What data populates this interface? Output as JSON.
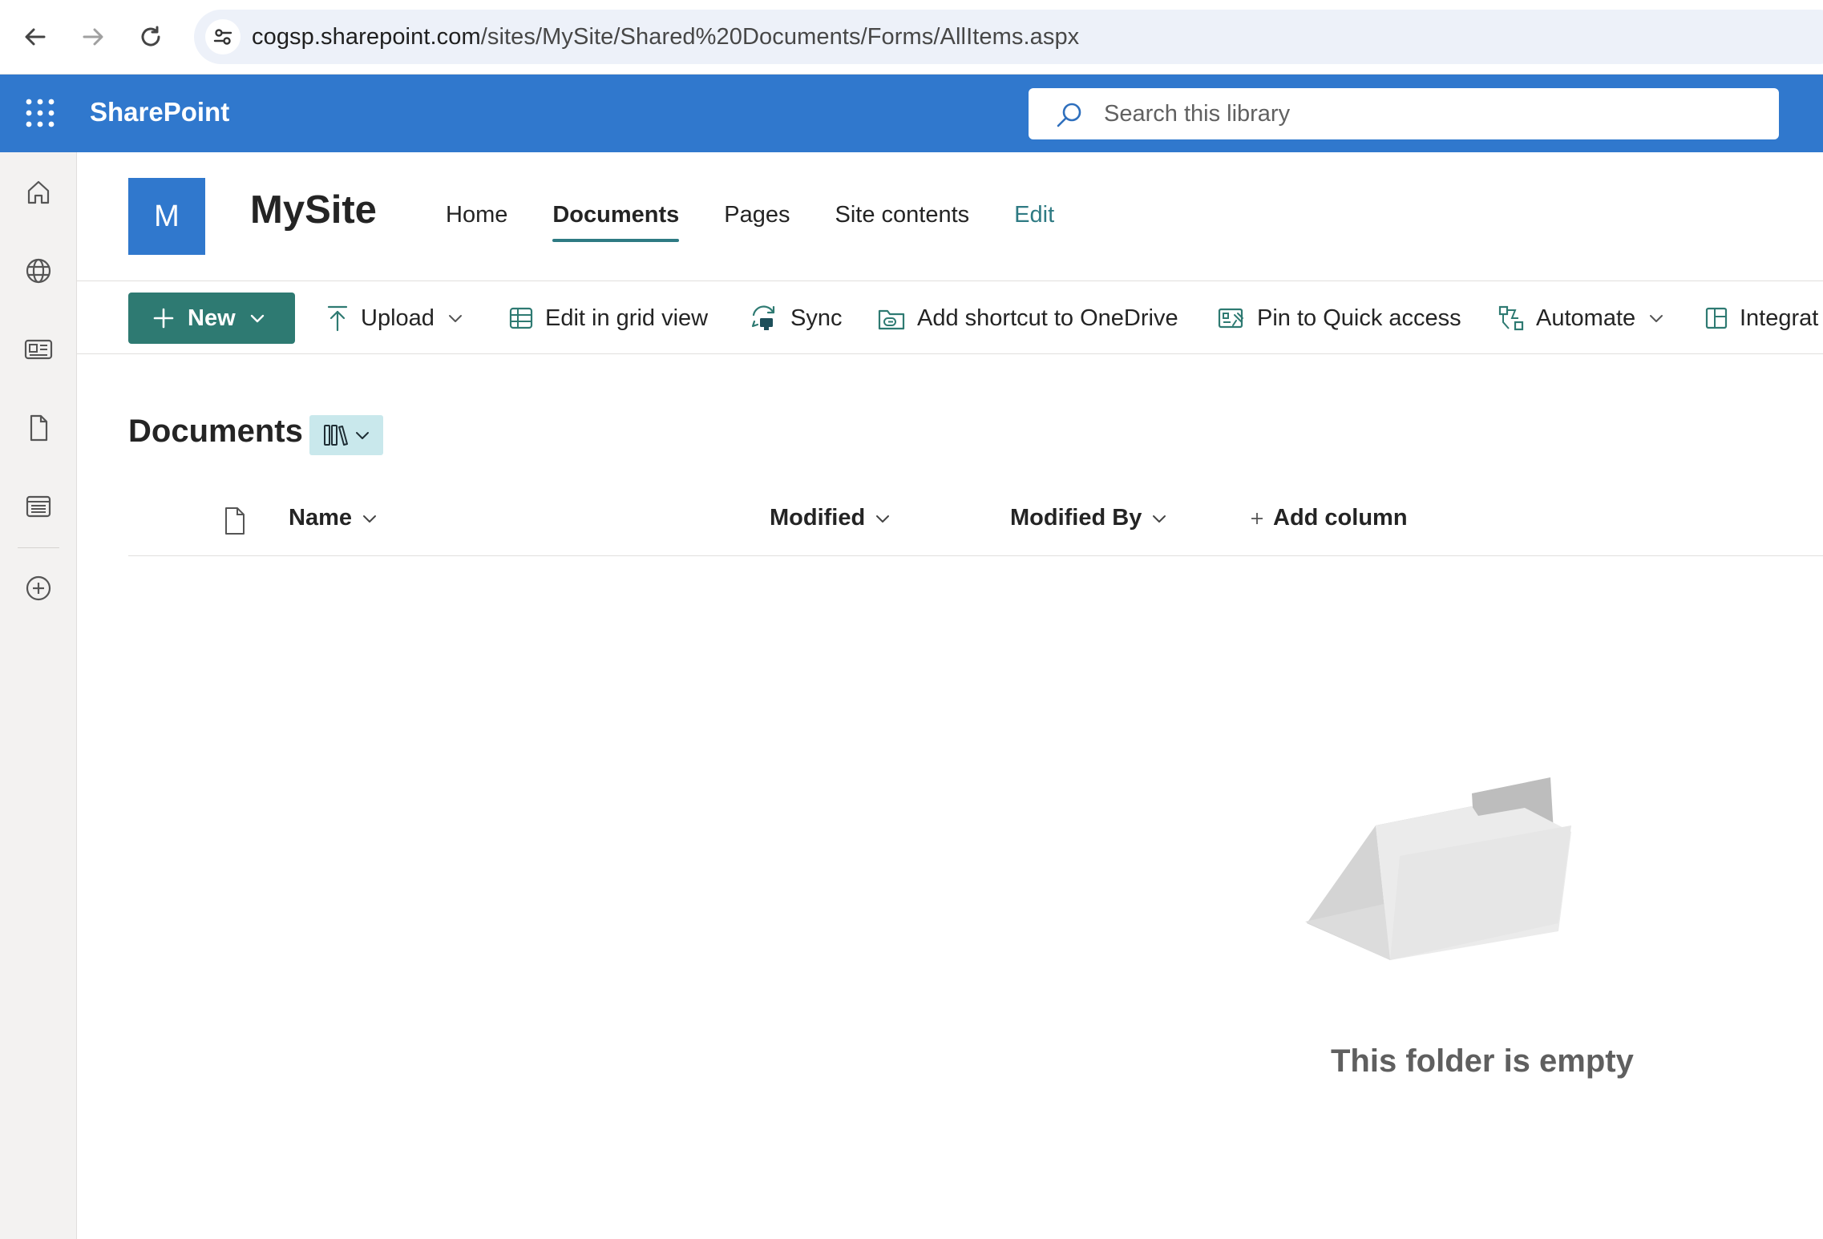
{
  "browser": {
    "url_host": "cogsp.sharepoint.com",
    "url_path": "/sites/MySite/Shared%20Documents/Forms/AllItems.aspx"
  },
  "suite": {
    "title": "SharePoint",
    "search_placeholder": "Search this library"
  },
  "site": {
    "logo_letter": "M",
    "title": "MySite",
    "nav": [
      {
        "label": "Home"
      },
      {
        "label": "Documents"
      },
      {
        "label": "Pages"
      },
      {
        "label": "Site contents"
      },
      {
        "label": "Edit"
      }
    ]
  },
  "commands": {
    "new": "New",
    "upload": "Upload",
    "edit_grid": "Edit in grid view",
    "sync": "Sync",
    "add_shortcut": "Add shortcut to OneDrive",
    "pin_quick": "Pin to Quick access",
    "automate": "Automate",
    "integrate": "Integrat"
  },
  "library": {
    "title": "Documents",
    "columns": {
      "name": "Name",
      "modified": "Modified",
      "modified_by": "Modified By",
      "add_column": "Add column"
    },
    "empty_message": "This folder is empty"
  },
  "colors": {
    "suite_blue": "#3078cd",
    "teal_accent": "#2e7a72"
  }
}
